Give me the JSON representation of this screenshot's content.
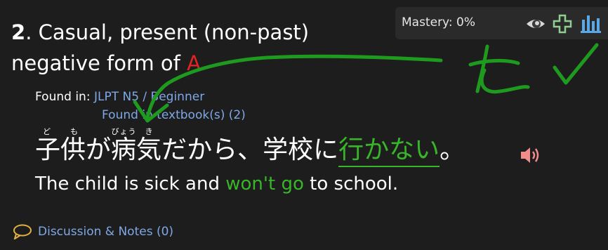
{
  "question": {
    "number": "2",
    "text_before": ". Casual, present (non-past) negative form of ",
    "target": "A"
  },
  "mastery": {
    "label": "Mastery: 0%",
    "icons": [
      "eye-icon",
      "plus-icon",
      "bar-chart-icon"
    ]
  },
  "found_in": {
    "label": "Found in: ",
    "link1": "JLPT N5 / Beginner",
    "link2": "Found in textbook(s) (2)"
  },
  "sentence": {
    "part1_base": "子供",
    "part1_ruby": "ども",
    "part2": "が",
    "byou": "病",
    "byou_ruby": "びょう",
    "ki": "気",
    "ki_ruby": "き",
    "part3": "だから、学校に",
    "answer": "行かない",
    "end": "。"
  },
  "english": {
    "before": "The child is sick and ",
    "highlight": "won't go",
    "after": " to school."
  },
  "discussion": {
    "label": "Discussion & Notes (0)"
  },
  "colors": {
    "background": "#1d1d1d",
    "target_red": "#e02424",
    "answer_green": "#38b528",
    "link_blue": "#7fa8e6",
    "icon_blue": "#5aa9e6"
  }
}
